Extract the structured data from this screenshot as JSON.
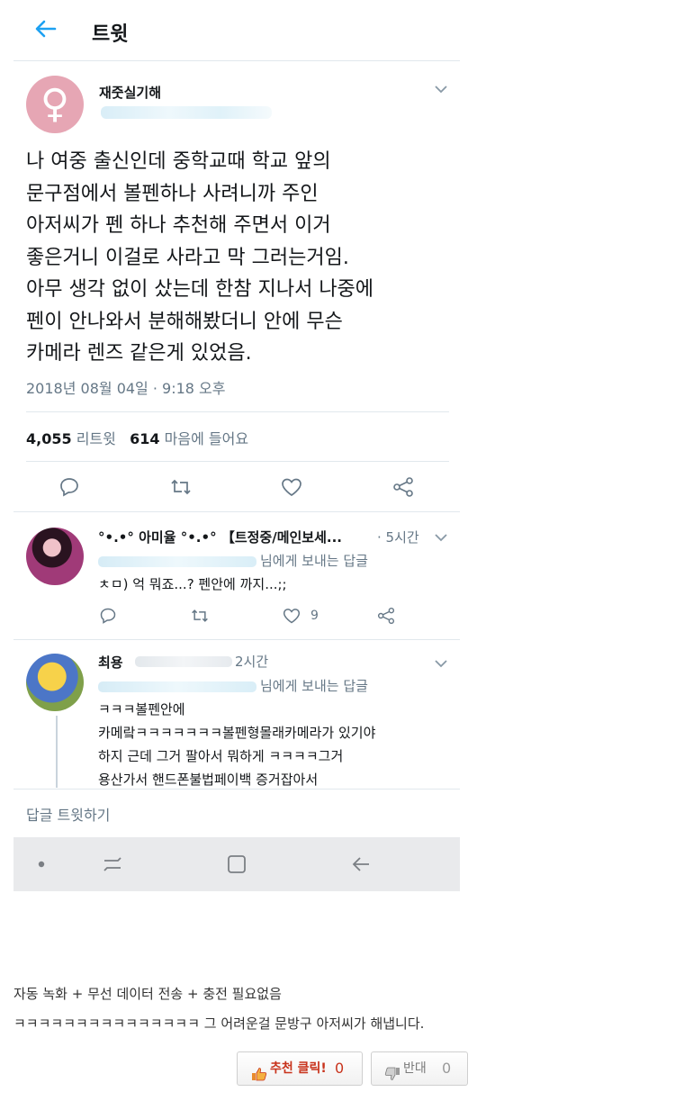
{
  "header": {
    "title": "트윗"
  },
  "tweet": {
    "author": "재줏실기해",
    "text": "나 여중 출신인데 중학교때 학교 앞의\n문구점에서 볼펜하나 사려니까 주인\n아저씨가 펜 하나 추천해 주면서  이거\n좋은거니 이걸로 사라고 막 그러는거임.\n아무 생각 없이 샀는데 한참 지나서 나중에\n펜이 안나와서 분해해봤더니 안에 무슨\n카메라 렌즈 같은게 있었음.",
    "date": "2018년 08월 04일 · 9:18 오후",
    "retweets_count": "4,055",
    "retweets_label": "리트윗",
    "likes_count": "614",
    "likes_label": "마음에 들어요"
  },
  "replies": [
    {
      "name": "°•.•° 아미율 °•.•° 【트정중/메인보세...",
      "time": "· 5시간",
      "reply_to": "님에게 보내는 답글",
      "text": "ㅊㅁ) 억 뭐죠...? 펜안에 까지...;;",
      "likes": "9"
    },
    {
      "name": "최용",
      "time": "2시간",
      "reply_to": "님에게 보내는 답글",
      "text": "ㅋㅋㅋ볼펜안에\n카메랔ㅋㅋㅋㅋㅋㅋㅋ볼펜형몰래카메라가 있기야\n하지 근데 그거 팔아서 뭐하게 ㅋㅋㅋㅋ그거\n용산가서 핸드폰불법페이백 증거잡아서"
    }
  ],
  "reply_prompt": "답글 트윗하기",
  "footer": {
    "caption_1": "자동 녹화 + 무선 데이터 전송 + 충전 필요없음",
    "caption_2": "ㅋㅋㅋㅋㅋㅋㅋㅋㅋㅋㅋㅋㅋㅋㅋ 그 어려운걸 문방구 아저씨가 해냅니다.",
    "upvote_label": "추천 클릭!",
    "upvote_count": "0",
    "downvote_label": "반대",
    "downvote_count": "0"
  },
  "colors": {
    "accent": "#1da1f2",
    "muted": "#657786",
    "upvote": "#c8331c"
  }
}
